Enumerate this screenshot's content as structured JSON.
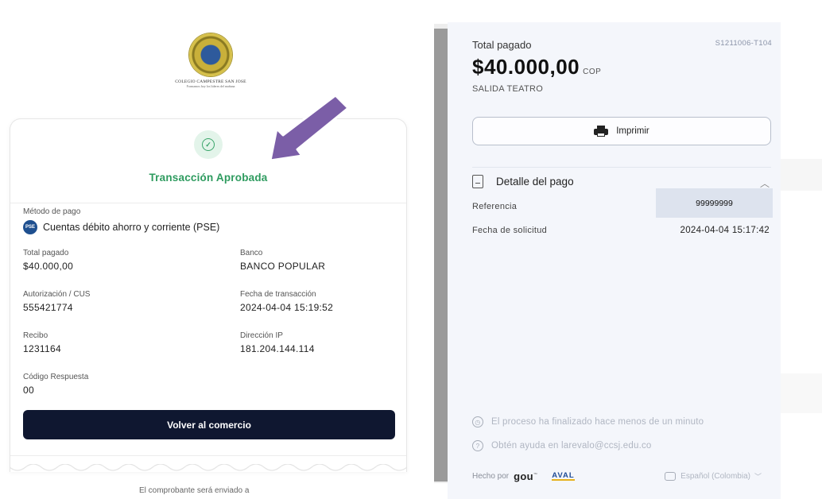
{
  "logo": {
    "name": "COLEGIO CAMPESTRE SAN JOSE",
    "tagline": "Formamos hoy los lideres del mañana"
  },
  "receipt": {
    "status": "Transacción Aprobada",
    "payment_method_label": "Método de pago",
    "payment_method_icon": "PSE",
    "payment_method_value": "Cuentas débito ahorro y corriente (PSE)",
    "fields": {
      "total_label": "Total pagado",
      "total_value": "$40.000,00",
      "bank_label": "Banco",
      "bank_value": "BANCO POPULAR",
      "auth_label": "Autorización / CUS",
      "auth_value": "555421774",
      "date_label": "Fecha de transacción",
      "date_value": "2024-04-04 15:19:52",
      "receipt_label": "Recibo",
      "receipt_value": "1231164",
      "ip_label": "Dirección IP",
      "ip_value": "181.204.144.114",
      "code_label": "Código Respuesta",
      "code_value": "00"
    },
    "back_button": "Volver al comercio",
    "footer_note": "El comprobante será enviado a"
  },
  "summary": {
    "total_label": "Total pagado",
    "order_code": "S1211006-T104",
    "amount": "$40.000,00",
    "currency": "COP",
    "description": "SALIDA TEATRO",
    "print_button": "Imprimir",
    "detail_title": "Detalle del pago",
    "reference_label": "Referencia",
    "reference_value": "99999999",
    "request_date_label": "Fecha de solicitud",
    "request_date_value": "2024-04-04 15:17:42",
    "process_note": "El proceso ha finalizado hace menos de un minuto",
    "help_note": "Obtén ayuda en larevalo@ccsj.edu.co",
    "made_by": "Hecho por",
    "brand_gou": "gou",
    "brand_aval": "AVAL",
    "language": "Español (Colombia)"
  },
  "colors": {
    "success": "#2e9b5f",
    "primary_button": "#0f1730",
    "arrow": "#7b5ea7",
    "panel_bg": "#f4f6fb"
  }
}
